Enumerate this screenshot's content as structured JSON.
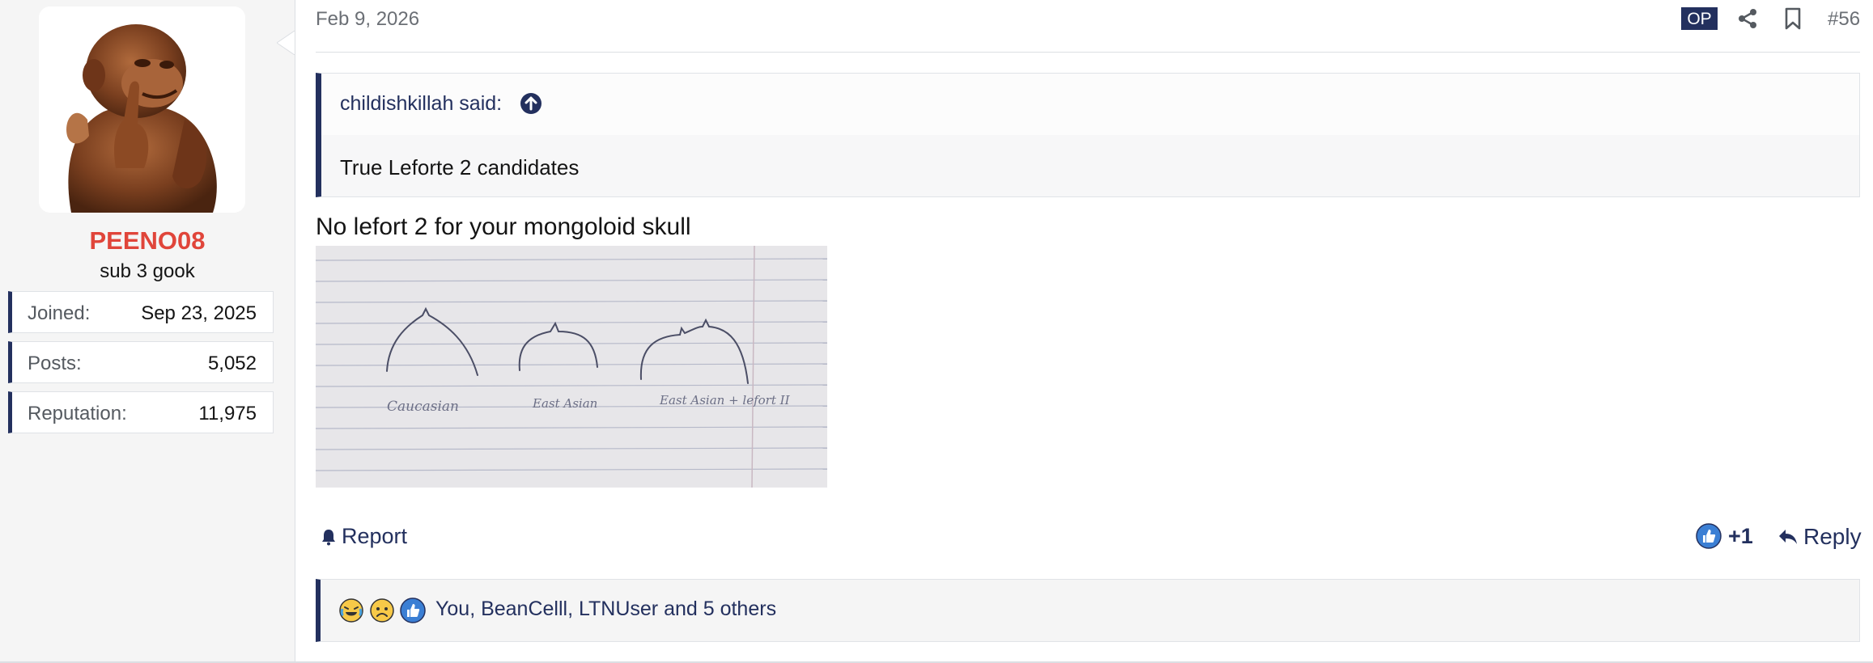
{
  "user": {
    "username": "PEENO08",
    "title": "sub 3 gook",
    "avatar_icon": "wooden-monkey-statue-avatar",
    "stats": [
      {
        "label": "Joined:",
        "value": "Sep 23, 2025"
      },
      {
        "label": "Posts:",
        "value": "5,052"
      },
      {
        "label": "Reputation:",
        "value": "11,975"
      }
    ]
  },
  "post": {
    "date": "Feb 9, 2026",
    "op_badge": "OP",
    "number": "#56",
    "icons": {
      "share": "share-icon",
      "bookmark": "bookmark-icon"
    },
    "quote": {
      "author": "childishkillah said:",
      "text": "True Leforte 2 candidates"
    },
    "text": "No lefort 2 for your mongoloid skull",
    "image": {
      "labels": [
        "Caucasian",
        "East Asian",
        "East Asian + lefort II"
      ]
    },
    "actions": {
      "report": "Report",
      "like_count": "+1",
      "reply": "Reply"
    },
    "reactions": {
      "icons": [
        "laughing-emoji-icon",
        "sad-emoji-icon",
        "like-icon"
      ],
      "text": "You, BeanCelll, LTNUser and 5 others"
    }
  },
  "colors": {
    "accent": "#23305e",
    "username": "#e0453a",
    "sidebar_bg": "#f5f5f5"
  }
}
